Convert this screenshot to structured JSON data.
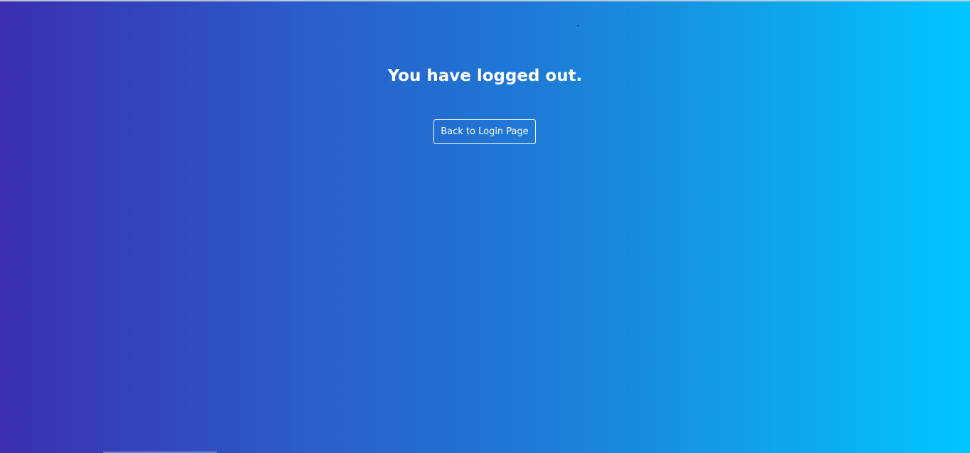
{
  "page": {
    "heading": "You have logged out.",
    "back_button_label": "Back to Login Page"
  },
  "colors": {
    "gradient_start": "#3b2fae",
    "gradient_end": "#00c6ff",
    "text": "#ffffff"
  }
}
